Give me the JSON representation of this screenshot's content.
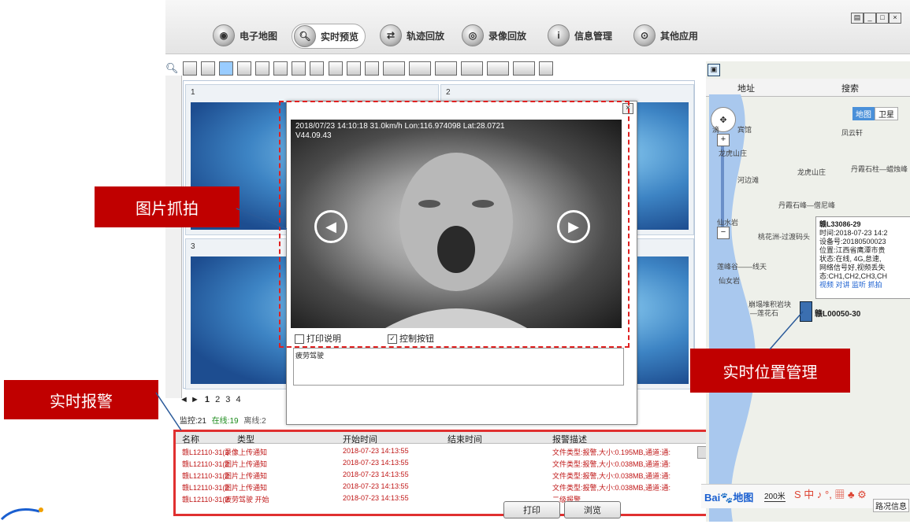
{
  "nav": {
    "items": [
      {
        "label": "电子地图",
        "icon": "globe-icon"
      },
      {
        "label": "实时预览",
        "icon": "search-icon"
      },
      {
        "label": "轨迹回放",
        "icon": "track-icon"
      },
      {
        "label": "录像回放",
        "icon": "video-icon"
      },
      {
        "label": "信息管理",
        "icon": "info-icon"
      },
      {
        "label": "其他应用",
        "icon": "apps-icon"
      }
    ]
  },
  "video_grid": {
    "cells": [
      {
        "num": "1"
      },
      {
        "num": "2"
      },
      {
        "num": "3"
      }
    ]
  },
  "pagination": {
    "prev": "◄",
    "next": "►",
    "pages": [
      "1",
      "2",
      "3",
      "4"
    ]
  },
  "status": {
    "monitor": "监控:21",
    "online": "在线:19",
    "offline": "离线:2"
  },
  "dialog": {
    "osd_line1": "2018/07/23 14:10:18  31.0km/h Lon:116.974098 Lat:28.0721",
    "osd_line2": "V44.09.43",
    "print_desc_label": "打印说明",
    "control_btn_label": "控制按钮",
    "note_text": "疲劳驾驶",
    "print_button": "打印",
    "browse_button": "浏览"
  },
  "alarm_table": {
    "headers": [
      "名称",
      "类型",
      "开始时间",
      "结束时间",
      "报警描述"
    ],
    "rows": [
      [
        "赣L12110-31(2",
        "录像上传通知",
        "2018-07-23 14:13:55",
        "",
        "文件类型:报警,大小:0.195MB,通道:通:"
      ],
      [
        "赣L12110-31(2",
        "图片上传通知",
        "2018-07-23 14:13:55",
        "",
        "文件类型:报警,大小:0.038MB,通道:通:"
      ],
      [
        "赣L12110-31(2",
        "图片上传通知",
        "2018-07-23 14:13:55",
        "",
        "文件类型:报警,大小:0.038MB,通道:通:"
      ],
      [
        "赣L12110-31(2",
        "图片上传通知",
        "2018-07-23 14:13:55",
        "",
        "文件类型:报警,大小:0.038MB,通道:通:"
      ],
      [
        "赣L12110-31(2",
        "疲劳驾驶 开始",
        "2018-07-23 14:13:55",
        "",
        "二级报警"
      ]
    ]
  },
  "map": {
    "address_label": "地址",
    "search_label": "搜索",
    "map_tab": "地图",
    "satellite_tab": "卫星",
    "places": [
      "凤云轩",
      "龙虎山庄",
      "丹霞石柱—蜡烛峰",
      "龙虎山庄",
      "丹霞石峰—僧尼峰",
      "仙水岩",
      "桃花洲-过渡码头",
      "莲峰谷——线天",
      "仙女岩",
      "崩塌堆积岩块",
      "—莲花石",
      "宾馆",
      "河边滩",
      "滴"
    ],
    "popup": {
      "plate": "赣L33086-29",
      "time": "时间:2018-07-23 14:2",
      "device": "设备号:20180500023",
      "position": "位置:江西省鹰潭市贵",
      "state": "状态:在线, 4G,怠速,",
      "network": "网络信号好,视频丢失",
      "channels": "态:CH1,CH2,CH3,CH",
      "actions": "视频 对讲 监听 抓拍"
    },
    "vehicle_label": "赣L00050-30",
    "scale": "200米",
    "bottom_tag": "路况信息"
  },
  "callouts": {
    "snapshot": "图片抓拍",
    "location": "实时位置管理",
    "alarm": "实时报警"
  },
  "colors": {
    "callout_red": "#c00000",
    "alarm_text": "#c01818",
    "highlight_red": "#e03030"
  }
}
